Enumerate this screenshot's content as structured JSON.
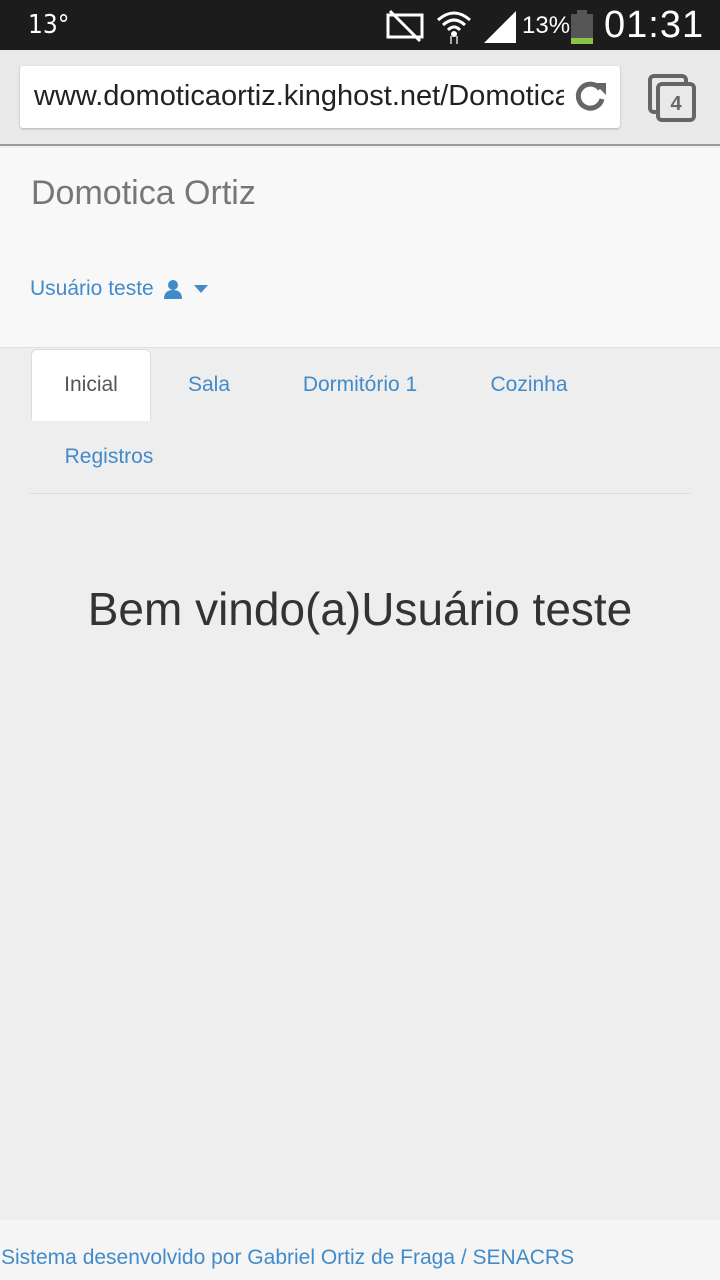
{
  "status_bar": {
    "temperature": "13°",
    "battery_percent": "13%",
    "time": "01:31"
  },
  "browser": {
    "url": "www.domoticaortiz.kinghost.net/Domotica",
    "tab_count": "4"
  },
  "navbar": {
    "brand": "Domotica Ortiz",
    "user_label": "Usuário teste"
  },
  "tabs": {
    "inicial": "Inicial",
    "sala": "Sala",
    "dormitorio": "Dormitório 1",
    "cozinha": "Cozinha",
    "registros": "Registros"
  },
  "main": {
    "welcome": "Bem vindo(a)Usuário teste"
  },
  "footer": {
    "text": "Sistema desenvolvido por Gabriel Ortiz de Fraga / SENACRS"
  },
  "colors": {
    "link": "#428bca",
    "navbar_bg": "#f8f8f8",
    "page_bg": "#eeeeee",
    "battery_level": "#8bc34a"
  }
}
